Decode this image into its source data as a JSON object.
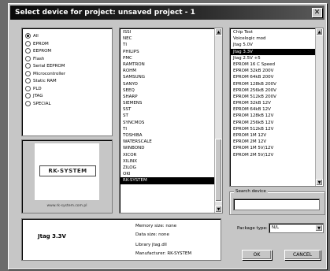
{
  "window": {
    "title": "Select device for project: unsaved project - 1",
    "close_glyph": "✕"
  },
  "device_types": {
    "options": [
      "All",
      "EPROM",
      "EEPROM",
      "Flash",
      "Serial EEPROM",
      "Microcontroller",
      "Static RAM",
      "PLD",
      "JTAG",
      "SPECIAL"
    ],
    "selected_index": 0
  },
  "logo": {
    "text": "RK-SYSTEM",
    "url": "www.rk-system.com.pl"
  },
  "manufacturers": {
    "items": [
      "ISSI",
      "NEC",
      "TI",
      "PHILIPS",
      "PMC",
      "RAMTRON",
      "ROHM",
      "SAMSUNG",
      "SANYO",
      "SEEQ",
      "SHARP",
      "SIEMENS",
      "SST",
      "ST",
      "SYNCMOS",
      "TI",
      "TOSHIBA",
      "WATERSCALE",
      "WINBOND",
      "XICOR",
      "XILINX",
      "ZILOG",
      "OKI",
      "RK-SYSTEM"
    ],
    "selected_index": 23
  },
  "devices": {
    "items": [
      "Chip Test",
      "Voicelogic mod",
      "Jtag 5.0V",
      "Jtag 3.3V",
      "Jtag 2.5V +5",
      "EPROM 16 C Speed",
      "EPROM 32kB 200V",
      "EPROM 64kB 200V",
      "EPROM 128kB 200V",
      "EPROM 256kB 200V",
      "EPROM 512kB 200V",
      "EPROM 32kB 12V",
      "EPROM 64kB 12V",
      "EPROM 128kB 12V",
      "EPROM 256kB 12V",
      "EPROM 512kB 12V",
      "EPROM 1M 12V",
      "EPROM 2M 12V",
      "EPROM 1M 5V/12V",
      "EPROM 2M 5V/12V"
    ],
    "selected_index": 3
  },
  "search": {
    "label": "Search device",
    "value": ""
  },
  "info": {
    "device_name": "Jtag 3.3V",
    "memory_size": "Memory size: none",
    "data_size": "Data size: none",
    "library": "Library jtag.dll",
    "manufacturer": "Manufacturer: RK-SYSTEM"
  },
  "package": {
    "label": "Package type:",
    "value": "N/L"
  },
  "buttons": {
    "ok": "OK",
    "cancel": "CANCEL"
  },
  "icons": {
    "scroll_up": "▲",
    "scroll_down": "▼",
    "combo_arrow": "▼"
  }
}
